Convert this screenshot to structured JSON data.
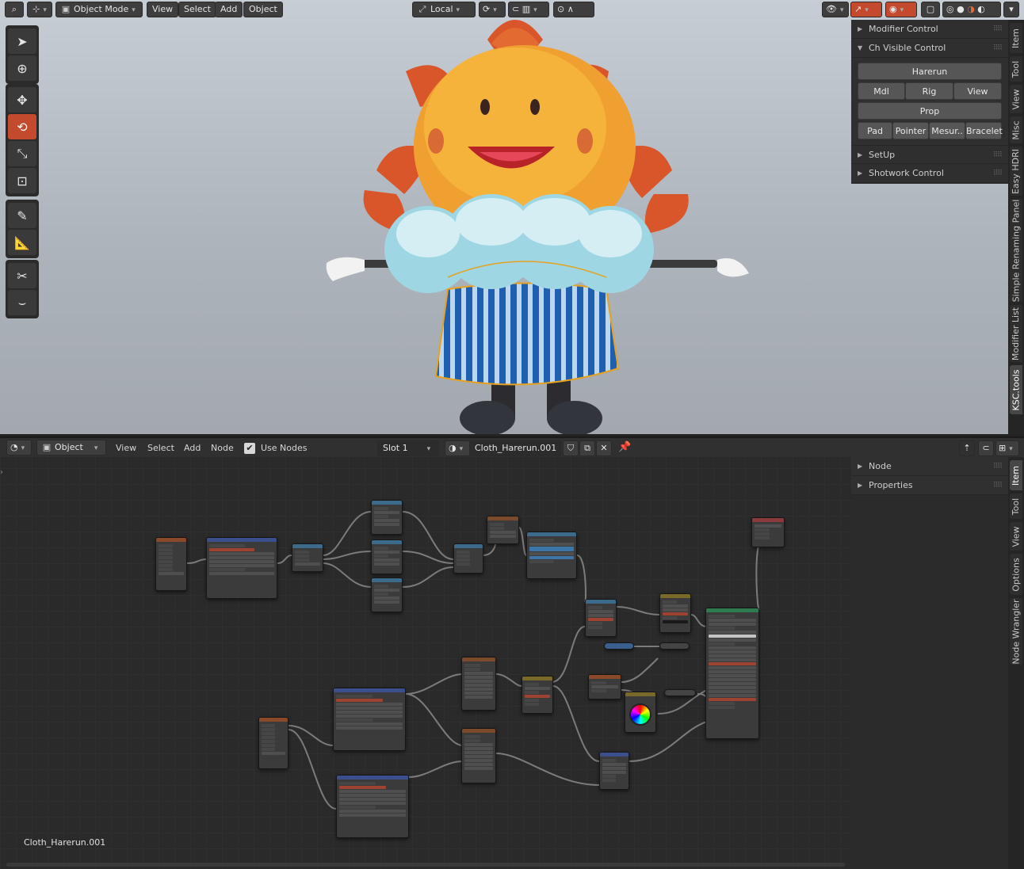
{
  "viewport_header": {
    "mode": "Object Mode",
    "menus": [
      "View",
      "Select",
      "Add",
      "Object"
    ],
    "transform_orientation": "Local"
  },
  "toolbar": {
    "tools": [
      "select-box-icon",
      "cursor-icon",
      "move-icon",
      "rotate-icon",
      "scale-icon",
      "transform-icon",
      "annotate-icon",
      "measure-icon",
      "knife-icon",
      "curve-icon"
    ],
    "active_tool_index": 3
  },
  "n_panel": {
    "rows": [
      {
        "label": "Modifier Control",
        "expanded": false
      },
      {
        "label": "Ch Visible Control",
        "expanded": true
      }
    ],
    "buttons": {
      "harerun": "Harerun",
      "mdl": "Mdl",
      "rig": "Rig",
      "view": "View",
      "prop": "Prop",
      "pad": "Pad",
      "pointer": "Pointer",
      "mesur": "Mesur..",
      "bracelet": "Bracelet"
    },
    "rows_after": [
      {
        "label": "SetUp"
      },
      {
        "label": "Shotwork Control"
      }
    ]
  },
  "viewport_tabs": [
    "Item",
    "Tool",
    "View",
    "Misc",
    "Easy HDRI",
    "Simple Renaming Panel",
    "Modifier List",
    "KSC.tools"
  ],
  "node_header": {
    "mode": "Object",
    "menus": [
      "View",
      "Select",
      "Add",
      "Node"
    ],
    "use_nodes_label": "Use Nodes",
    "use_nodes_checked": true,
    "slot": "Slot 1",
    "material": "Cloth_Harerun.001"
  },
  "node_panel": {
    "rows": [
      {
        "label": "Node"
      },
      {
        "label": "Properties"
      }
    ]
  },
  "node_tabs": [
    "Item",
    "Tool",
    "View",
    "Options",
    "Node Wrangler"
  ],
  "material_name_overlay": "Cloth_Harerun.001",
  "colors": {
    "active_tool": "#c34a2c",
    "node_bg": "#2a2a2a",
    "panel_bg": "#2f2f2f"
  }
}
